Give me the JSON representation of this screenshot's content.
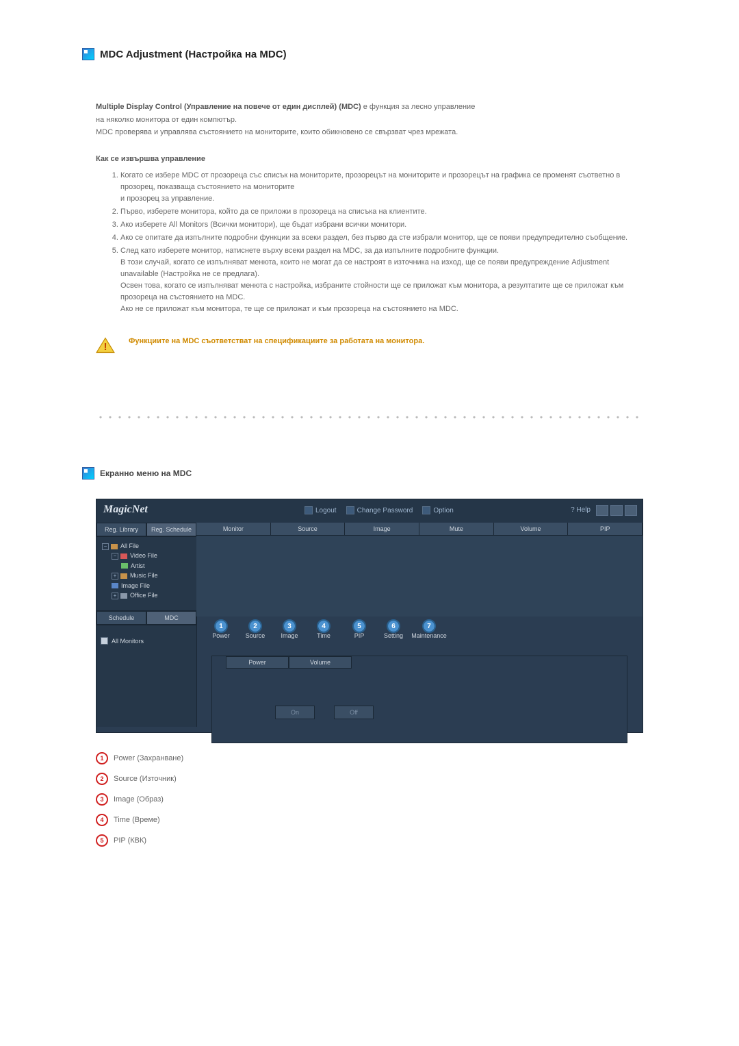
{
  "heading": "MDC Adjustment (Настройка на MDC)",
  "intro": {
    "bold": "Multiple Display Control (Управление на повече от един дисплей) (MDC)",
    "after_bold": " е функция за лесно управление",
    "line2": "на няколко монитора от един компютър.",
    "line3": "MDC проверява и управлява състоянието на мониторите, които обикновено се свързват чрез мрежата."
  },
  "howto_head": "Как се извършва управление",
  "steps": [
    "Когато се избере MDC от прозореца със списък на мониторите, прозорецът на мониторите и прозорецът на графика се променят съответно в прозорец, показваща състоянието на мониторите\nи прозорец за управление.",
    "Първо, изберете монитора, който да се приложи в прозореца на списъка на клиентите.",
    "Ако изберете All Monitors (Всички монитори), ще бъдат избрани всички монитори.",
    "Ако се опитате да изпълните подробни функции за всеки раздел, без първо да сте избрали монитор, ще се появи предупредително съобщение.",
    "След като изберете монитор, натиснете върху всеки раздел на MDC, за да изпълните подробните функции.\nВ този случай, когато се изпълняват менюта, които не могат да се настроят в източника на изход, ще се появи предупреждение Adjustment unavailable (Настройка не се предлага).\nОсвен това, когато се изпълняват менюта с настройка, избраните стойности ще се приложат към монитора, а резултатите ще се приложат към прозореца на състоянието на MDC.\nАко не се приложат към монитора, те ще се приложат и към прозореца на състоянието на MDC."
  ],
  "warn": "Функциите на MDC съответстват на спецификациите за работата на монитора.",
  "sub2": "Екранно меню на MDC",
  "shot": {
    "brand": "MagicNet",
    "top_buttons": [
      "Logout",
      "Change Password",
      "Option"
    ],
    "help": "Help",
    "left_tabs": [
      "Reg. Library",
      "Reg. Schedule"
    ],
    "tree": {
      "root": "All File",
      "items": [
        "Video File",
        "Artist",
        "Music File",
        "Image File",
        "Office File"
      ]
    },
    "bottom_tabs": [
      "Schedule",
      "MDC"
    ],
    "all_monitors": "All Monitors",
    "grid_cols": [
      "Monitor",
      "Source",
      "Image",
      "Mute",
      "Volume",
      "PIP"
    ],
    "num_buttons": [
      "Power",
      "Source",
      "Image",
      "Time",
      "PIP",
      "Setting",
      "Maintenance"
    ],
    "cp_heads": [
      "Power",
      "Volume"
    ],
    "cp_btns": [
      "On",
      "Off"
    ]
  },
  "legend": [
    "Power (Захранване)",
    "Source (Източник)",
    "Image (Образ)",
    "Time (Време)",
    "PIP (КВК)"
  ]
}
